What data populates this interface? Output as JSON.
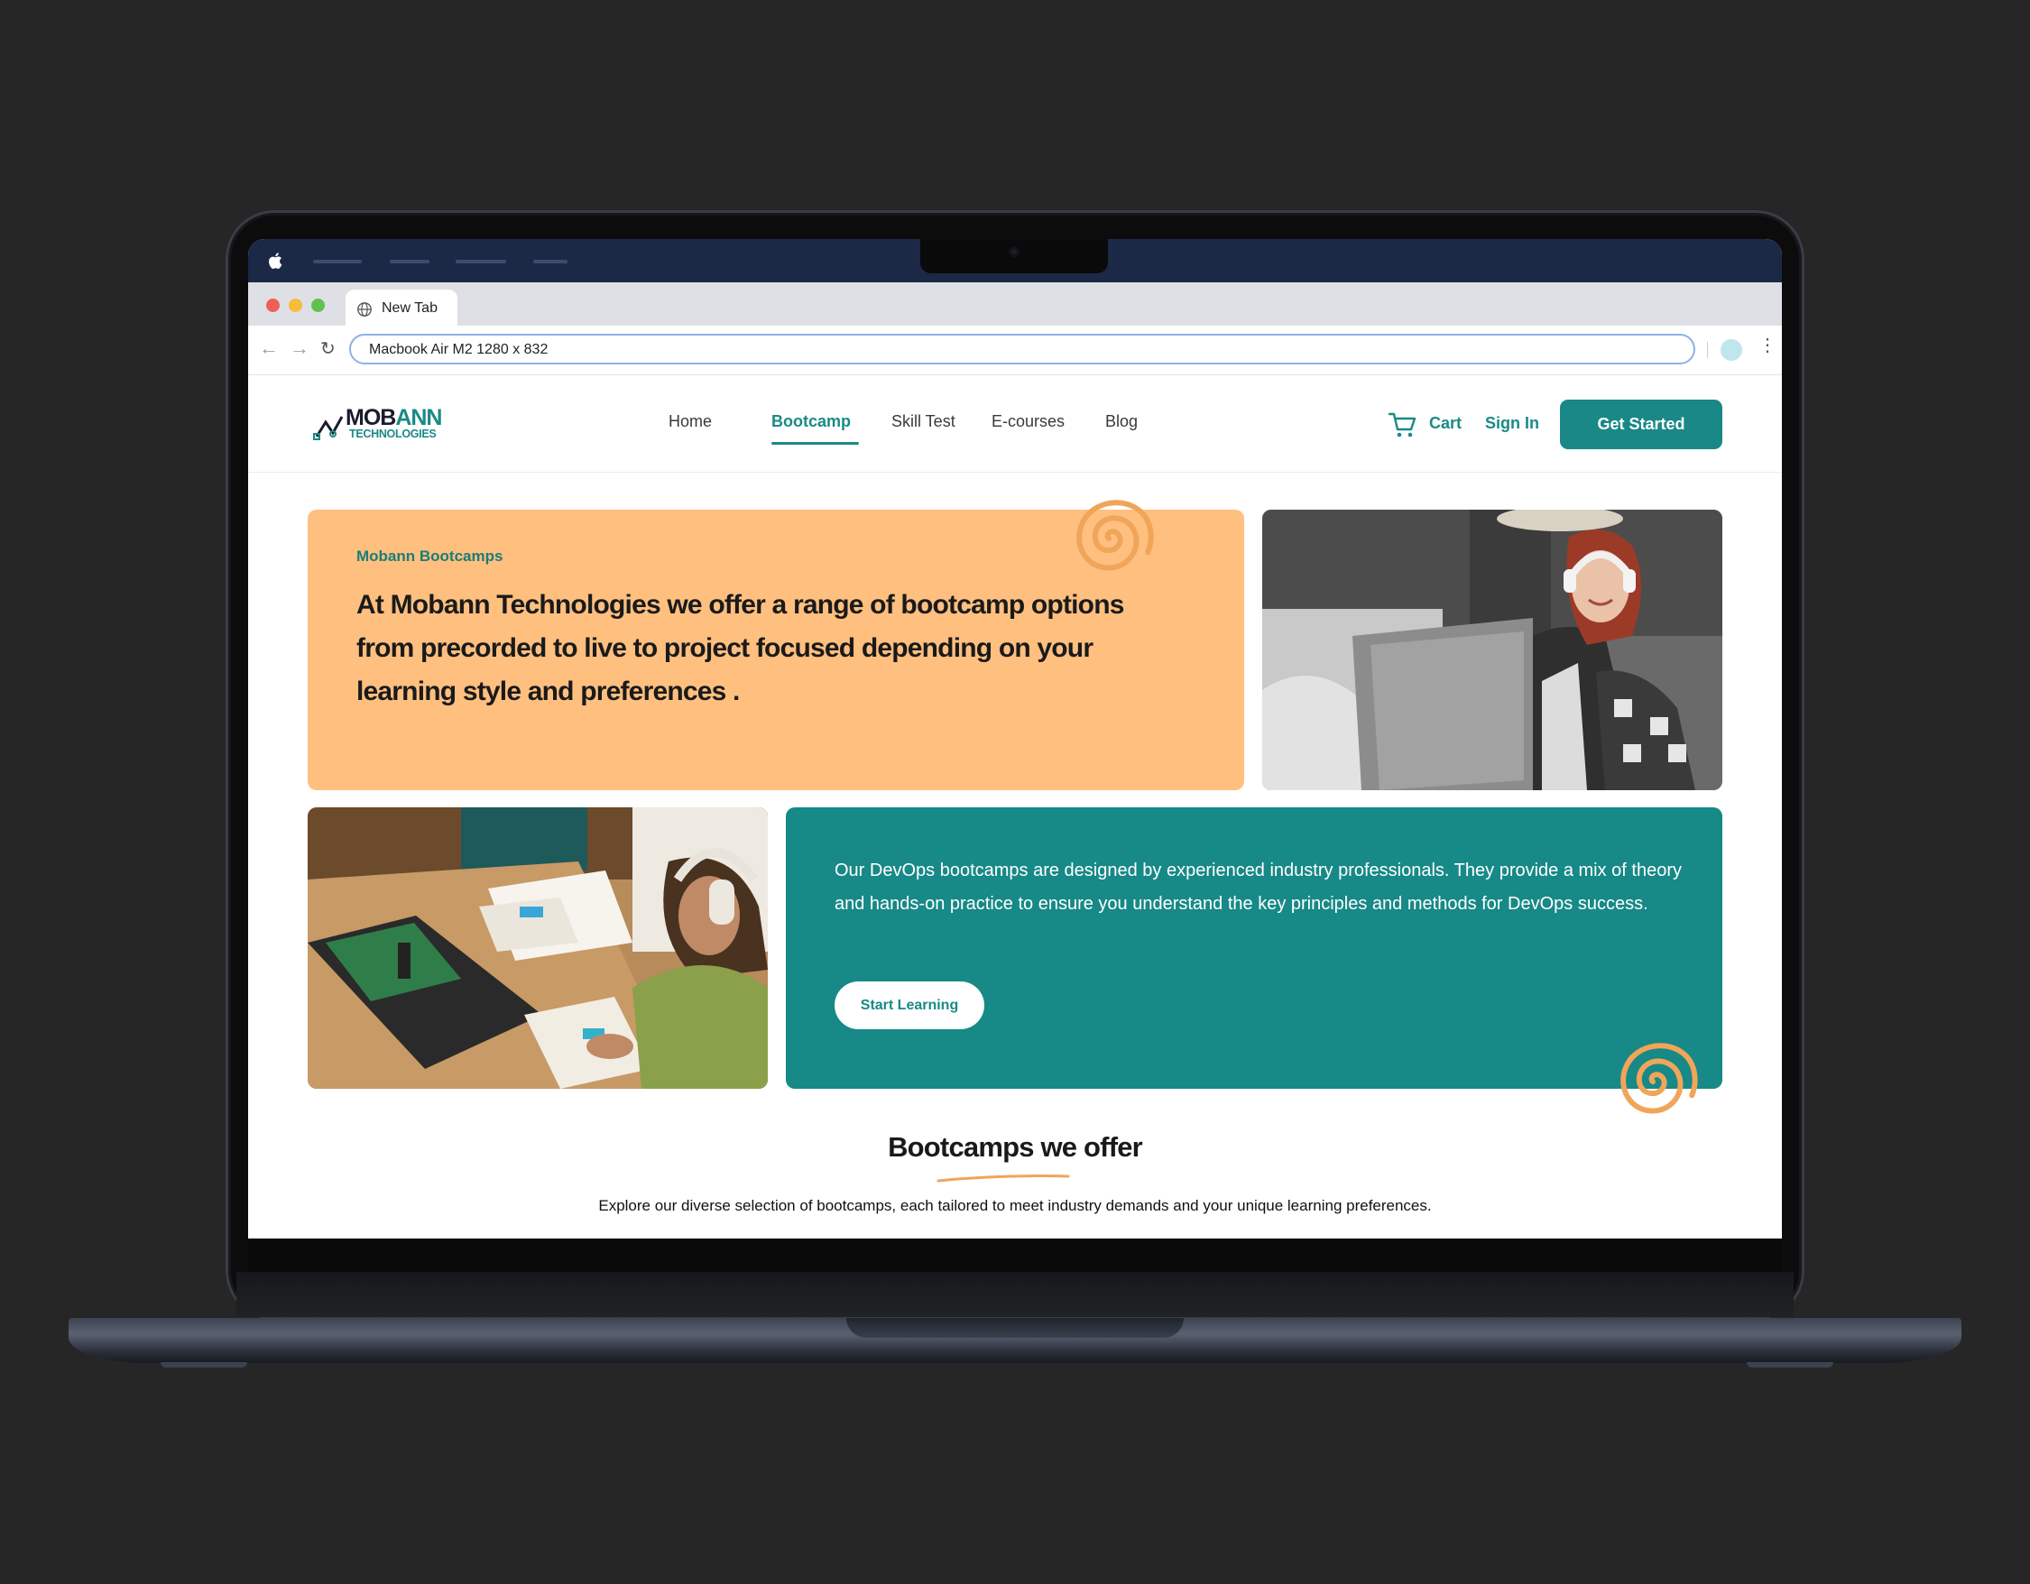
{
  "browser": {
    "tab_title": "New Tab",
    "address": "Macbook Air M2  1280 x 832"
  },
  "site": {
    "logo": {
      "name_part1": "MOB",
      "name_part2": "ANN",
      "sub": "TECHNOLOGIES"
    },
    "nav": [
      {
        "label": "Home",
        "active": false
      },
      {
        "label": "Bootcamp",
        "active": true
      },
      {
        "label": "Skill Test",
        "active": false
      },
      {
        "label": "E-courses",
        "active": false
      },
      {
        "label": "Blog",
        "active": false
      }
    ],
    "cart_label": "Cart",
    "signin_label": "Sign In",
    "cta_label": "Get Started",
    "hero": {
      "eyebrow": "Mobann Bootcamps",
      "heading": "At Mobann Technologies we offer a range of bootcamp options from precorded to live to project focused depending on your learning style and preferences ."
    },
    "devops": {
      "text": "Our DevOps bootcamps are designed by experienced industry professionals. They provide a mix of theory and hands-on practice to ensure you understand the key principles and methods for DevOps success.",
      "button": "Start Learning"
    },
    "section": {
      "title": "Bootcamps we offer",
      "subtitle": "Explore our diverse selection of bootcamps, each tailored to meet industry demands and your unique learning preferences."
    }
  },
  "colors": {
    "brand_teal": "#198886",
    "hero_orange": "#ffbf7f",
    "accent_orange": "#f0a559",
    "menubar_navy": "#1b2946"
  }
}
